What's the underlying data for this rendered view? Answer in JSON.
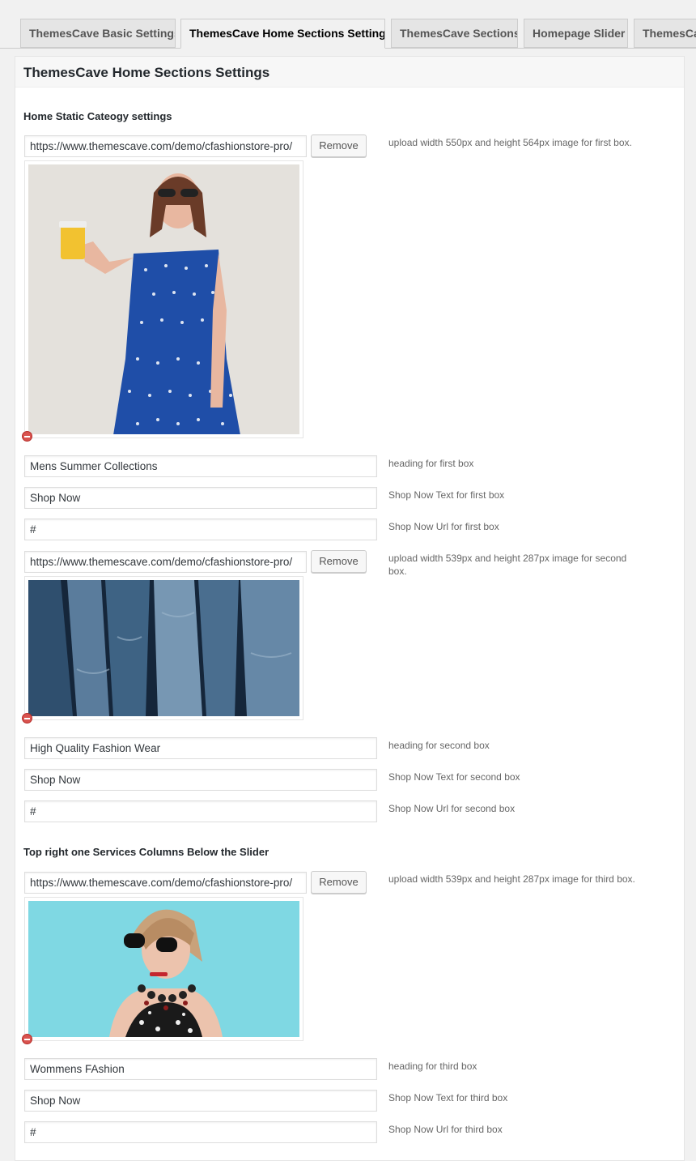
{
  "tabs": [
    "ThemesCave Basic Settings",
    "ThemesCave Home Sections Settings",
    "ThemesCave Sections",
    "Homepage Slider",
    "ThemesCave"
  ],
  "panel_title": "ThemesCave Home Sections Settings",
  "section1_title": "Home Static Cateogy settings",
  "section2_title": "Top right one Services Columns Below the Slider",
  "remove_label": "Remove",
  "box1": {
    "image_url": "https://www.themescave.com/demo/cfashionstore-pro/",
    "image_hint": "upload width 550px and height 564px image for first box.",
    "heading_value": "Mens Summer Collections",
    "heading_hint": "heading for first box",
    "shop_text_value": "Shop Now",
    "shop_text_hint": "Shop Now Text for first box",
    "shop_url_value": "#",
    "shop_url_hint": "Shop Now Url for first box"
  },
  "box2": {
    "image_url": "https://www.themescave.com/demo/cfashionstore-pro/",
    "image_hint": "upload width 539px and height 287px image for second box.",
    "heading_value": "High Quality Fashion Wear",
    "heading_hint": "heading for second box",
    "shop_text_value": "Shop Now",
    "shop_text_hint": "Shop Now Text for second box",
    "shop_url_value": "#",
    "shop_url_hint": "Shop Now Url for second box"
  },
  "box3": {
    "image_url": "https://www.themescave.com/demo/cfashionstore-pro/",
    "image_hint": "upload width 539px and height 287px image for third box.",
    "heading_value": "Wommens FAshion",
    "heading_hint": "heading for third box",
    "shop_text_value": "Shop Now",
    "shop_text_hint": "Shop Now Text for third box",
    "shop_url_value": "#",
    "shop_url_hint": "Shop Now Url for third box"
  }
}
